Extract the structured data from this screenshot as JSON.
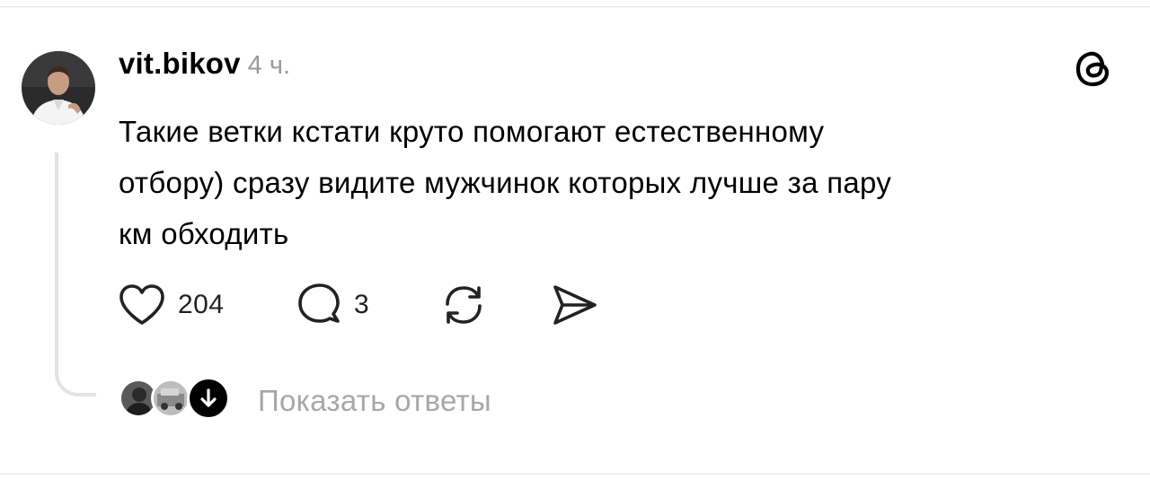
{
  "post": {
    "author": "vit.bikov",
    "time": "4 ч.",
    "text_lines": [
      "Такие ветки кстати круто помогают естественному",
      "отбору) сразу видите мужчинок которых лучше за пару",
      "км обходить"
    ]
  },
  "actions": {
    "like_count": "204",
    "comment_count": "3"
  },
  "replies": {
    "show_label": "Показать ответы"
  },
  "icons": {
    "like": "heart-icon",
    "comment": "speech-bubble-icon",
    "repost": "repost-icon",
    "share": "send-icon",
    "brand": "threads-logo-icon",
    "expand": "arrow-down-icon"
  }
}
